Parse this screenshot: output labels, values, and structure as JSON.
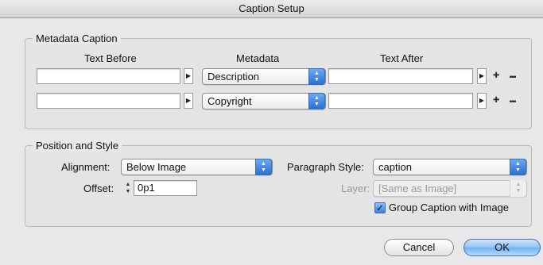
{
  "window": {
    "title": "Caption Setup"
  },
  "metadata_caption": {
    "group_label": "Metadata Caption",
    "headers": {
      "text_before": "Text Before",
      "metadata": "Metadata",
      "text_after": "Text After"
    },
    "rows": [
      {
        "text_before": "",
        "metadata": "Description",
        "text_after": ""
      },
      {
        "text_before": "",
        "metadata": "Copyright",
        "text_after": ""
      }
    ],
    "add_symbol": "✚",
    "remove_symbol": "▬"
  },
  "position_style": {
    "group_label": "Position and Style",
    "alignment_label": "Alignment:",
    "alignment_value": "Below Image",
    "offset_label": "Offset:",
    "offset_value": "0p1",
    "paragraph_style_label": "Paragraph Style:",
    "paragraph_style_value": "caption",
    "layer_label": "Layer:",
    "layer_value": "[Same as Image]",
    "group_caption_label": "Group Caption with Image",
    "group_caption_checked": true
  },
  "buttons": {
    "cancel": "Cancel",
    "ok": "OK"
  }
}
